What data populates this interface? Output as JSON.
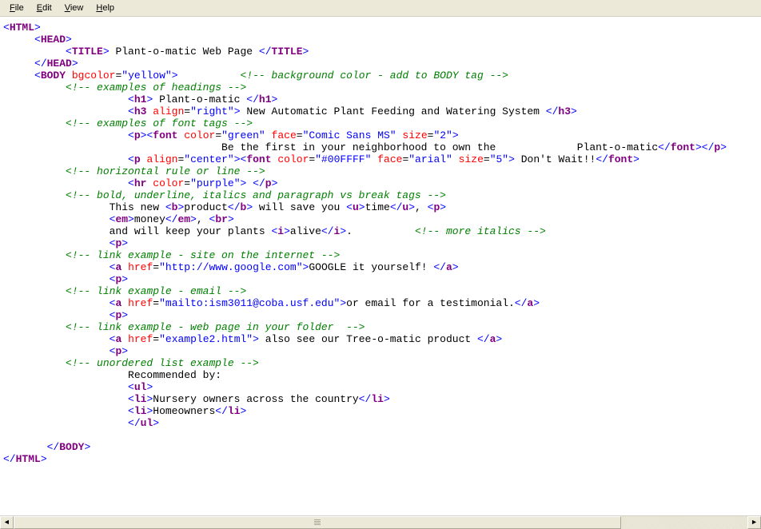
{
  "menubar": {
    "items": [
      {
        "hot": "F",
        "rest": "ile"
      },
      {
        "hot": "E",
        "rest": "dit"
      },
      {
        "hot": "V",
        "rest": "iew"
      },
      {
        "hot": "H",
        "rest": "elp"
      }
    ]
  },
  "code": {
    "lines": [
      [
        [
          "punct",
          "<"
        ],
        [
          "tag",
          "HTML"
        ],
        [
          "punct",
          ">"
        ]
      ],
      [
        [
          "plain",
          "     "
        ],
        [
          "punct",
          "<"
        ],
        [
          "tag",
          "HEAD"
        ],
        [
          "punct",
          ">"
        ]
      ],
      [
        [
          "plain",
          "          "
        ],
        [
          "punct",
          "<"
        ],
        [
          "tag",
          "TITLE"
        ],
        [
          "punct",
          ">"
        ],
        [
          "plain",
          " Plant-o-matic Web Page "
        ],
        [
          "punct",
          "</"
        ],
        [
          "tag",
          "TITLE"
        ],
        [
          "punct",
          ">"
        ]
      ],
      [
        [
          "plain",
          "     "
        ],
        [
          "punct",
          "</"
        ],
        [
          "tag",
          "HEAD"
        ],
        [
          "punct",
          ">"
        ]
      ],
      [
        [
          "plain",
          "     "
        ],
        [
          "punct",
          "<"
        ],
        [
          "tag",
          "BODY"
        ],
        [
          "plain",
          " "
        ],
        [
          "attr",
          "bgcolor"
        ],
        [
          "plain",
          "="
        ],
        [
          "val",
          "\"yellow\""
        ],
        [
          "punct",
          ">"
        ],
        [
          "plain",
          "          "
        ],
        [
          "cmt",
          "<!-- background color - add to BODY tag -->"
        ]
      ],
      [
        [
          "plain",
          "          "
        ],
        [
          "cmt",
          "<!-- examples of headings -->"
        ]
      ],
      [
        [
          "plain",
          "                    "
        ],
        [
          "punct",
          "<"
        ],
        [
          "tag",
          "h1"
        ],
        [
          "punct",
          ">"
        ],
        [
          "plain",
          " Plant-o-matic "
        ],
        [
          "punct",
          "</"
        ],
        [
          "tag",
          "h1"
        ],
        [
          "punct",
          ">"
        ]
      ],
      [
        [
          "plain",
          "                    "
        ],
        [
          "punct",
          "<"
        ],
        [
          "tag",
          "h3"
        ],
        [
          "plain",
          " "
        ],
        [
          "attr",
          "align"
        ],
        [
          "plain",
          "="
        ],
        [
          "val",
          "\"right\""
        ],
        [
          "punct",
          ">"
        ],
        [
          "plain",
          " New Automatic Plant Feeding and Watering System "
        ],
        [
          "punct",
          "</"
        ],
        [
          "tag",
          "h3"
        ],
        [
          "punct",
          ">"
        ]
      ],
      [
        [
          "plain",
          "          "
        ],
        [
          "cmt",
          "<!-- examples of font tags -->"
        ]
      ],
      [
        [
          "plain",
          "                    "
        ],
        [
          "punct",
          "<"
        ],
        [
          "tag",
          "p"
        ],
        [
          "punct",
          "><"
        ],
        [
          "tag",
          "font"
        ],
        [
          "plain",
          " "
        ],
        [
          "attr",
          "color"
        ],
        [
          "plain",
          "="
        ],
        [
          "val",
          "\"green\""
        ],
        [
          "plain",
          " "
        ],
        [
          "attr",
          "face"
        ],
        [
          "plain",
          "="
        ],
        [
          "val",
          "\"Comic Sans MS\""
        ],
        [
          "plain",
          " "
        ],
        [
          "attr",
          "size"
        ],
        [
          "plain",
          "="
        ],
        [
          "val",
          "\"2\""
        ],
        [
          "punct",
          ">"
        ]
      ],
      [
        [
          "plain",
          "                                   Be the first in your neighborhood to own the             Plant-o-matic"
        ],
        [
          "punct",
          "</"
        ],
        [
          "tag",
          "font"
        ],
        [
          "punct",
          "></"
        ],
        [
          "tag",
          "p"
        ],
        [
          "punct",
          ">"
        ]
      ],
      [
        [
          "plain",
          "                    "
        ],
        [
          "punct",
          "<"
        ],
        [
          "tag",
          "p"
        ],
        [
          "plain",
          " "
        ],
        [
          "attr",
          "align"
        ],
        [
          "plain",
          "="
        ],
        [
          "val",
          "\"center\""
        ],
        [
          "punct",
          "><"
        ],
        [
          "tag",
          "font"
        ],
        [
          "plain",
          " "
        ],
        [
          "attr",
          "color"
        ],
        [
          "plain",
          "="
        ],
        [
          "val",
          "\"#00FFFF\""
        ],
        [
          "plain",
          " "
        ],
        [
          "attr",
          "face"
        ],
        [
          "plain",
          "="
        ],
        [
          "val",
          "\"arial\""
        ],
        [
          "plain",
          " "
        ],
        [
          "attr",
          "size"
        ],
        [
          "plain",
          "="
        ],
        [
          "val",
          "\"5\""
        ],
        [
          "punct",
          ">"
        ],
        [
          "plain",
          " Don't Wait!!"
        ],
        [
          "punct",
          "</"
        ],
        [
          "tag",
          "font"
        ],
        [
          "punct",
          ">"
        ]
      ],
      [
        [
          "plain",
          "          "
        ],
        [
          "cmt",
          "<!-- horizontal rule or line -->"
        ]
      ],
      [
        [
          "plain",
          "                    "
        ],
        [
          "punct",
          "<"
        ],
        [
          "tag",
          "hr"
        ],
        [
          "plain",
          " "
        ],
        [
          "attr",
          "color"
        ],
        [
          "plain",
          "="
        ],
        [
          "val",
          "\"purple\""
        ],
        [
          "punct",
          ">"
        ],
        [
          "plain",
          " "
        ],
        [
          "punct",
          "</"
        ],
        [
          "tag",
          "p"
        ],
        [
          "punct",
          ">"
        ]
      ],
      [
        [
          "plain",
          "          "
        ],
        [
          "cmt",
          "<!-- bold, underline, italics and paragraph vs break tags -->"
        ]
      ],
      [
        [
          "plain",
          "                 This new "
        ],
        [
          "punct",
          "<"
        ],
        [
          "tag",
          "b"
        ],
        [
          "punct",
          ">"
        ],
        [
          "plain",
          "product"
        ],
        [
          "punct",
          "</"
        ],
        [
          "tag",
          "b"
        ],
        [
          "punct",
          ">"
        ],
        [
          "plain",
          " will save you "
        ],
        [
          "punct",
          "<"
        ],
        [
          "tag",
          "u"
        ],
        [
          "punct",
          ">"
        ],
        [
          "plain",
          "time"
        ],
        [
          "punct",
          "</"
        ],
        [
          "tag",
          "u"
        ],
        [
          "punct",
          ">"
        ],
        [
          "plain",
          ", "
        ],
        [
          "punct",
          "<"
        ],
        [
          "tag",
          "p"
        ],
        [
          "punct",
          ">"
        ]
      ],
      [
        [
          "plain",
          "                 "
        ],
        [
          "punct",
          "<"
        ],
        [
          "tag",
          "em"
        ],
        [
          "punct",
          ">"
        ],
        [
          "plain",
          "money"
        ],
        [
          "punct",
          "</"
        ],
        [
          "tag",
          "em"
        ],
        [
          "punct",
          ">"
        ],
        [
          "plain",
          ", "
        ],
        [
          "punct",
          "<"
        ],
        [
          "tag",
          "br"
        ],
        [
          "punct",
          ">"
        ]
      ],
      [
        [
          "plain",
          "                 and will keep your plants "
        ],
        [
          "punct",
          "<"
        ],
        [
          "tag",
          "i"
        ],
        [
          "punct",
          ">"
        ],
        [
          "plain",
          "alive"
        ],
        [
          "punct",
          "</"
        ],
        [
          "tag",
          "i"
        ],
        [
          "punct",
          ">"
        ],
        [
          "plain",
          ".          "
        ],
        [
          "cmt",
          "<!-- more italics -->"
        ]
      ],
      [
        [
          "plain",
          "                 "
        ],
        [
          "punct",
          "<"
        ],
        [
          "tag",
          "p"
        ],
        [
          "punct",
          ">"
        ]
      ],
      [
        [
          "plain",
          "          "
        ],
        [
          "cmt",
          "<!-- link example - site on the internet -->"
        ]
      ],
      [
        [
          "plain",
          "                 "
        ],
        [
          "punct",
          "<"
        ],
        [
          "tag",
          "a"
        ],
        [
          "plain",
          " "
        ],
        [
          "attr",
          "href"
        ],
        [
          "plain",
          "="
        ],
        [
          "val",
          "\"http://www.google.com\""
        ],
        [
          "punct",
          ">"
        ],
        [
          "plain",
          "GOOGLE it yourself! "
        ],
        [
          "punct",
          "</"
        ],
        [
          "tag",
          "a"
        ],
        [
          "punct",
          ">"
        ]
      ],
      [
        [
          "plain",
          "                 "
        ],
        [
          "punct",
          "<"
        ],
        [
          "tag",
          "p"
        ],
        [
          "punct",
          ">"
        ]
      ],
      [
        [
          "plain",
          "          "
        ],
        [
          "cmt",
          "<!-- link example - email -->"
        ]
      ],
      [
        [
          "plain",
          "                 "
        ],
        [
          "punct",
          "<"
        ],
        [
          "tag",
          "a"
        ],
        [
          "plain",
          " "
        ],
        [
          "attr",
          "href"
        ],
        [
          "plain",
          "="
        ],
        [
          "val",
          "\"mailto:ism3011@coba.usf.edu\""
        ],
        [
          "punct",
          ">"
        ],
        [
          "plain",
          "or email for a testimonial."
        ],
        [
          "punct",
          "</"
        ],
        [
          "tag",
          "a"
        ],
        [
          "punct",
          ">"
        ]
      ],
      [
        [
          "plain",
          "                 "
        ],
        [
          "punct",
          "<"
        ],
        [
          "tag",
          "p"
        ],
        [
          "punct",
          ">"
        ]
      ],
      [
        [
          "plain",
          "          "
        ],
        [
          "cmt",
          "<!-- link example - web page in your folder  -->"
        ]
      ],
      [
        [
          "plain",
          "                 "
        ],
        [
          "punct",
          "<"
        ],
        [
          "tag",
          "a"
        ],
        [
          "plain",
          " "
        ],
        [
          "attr",
          "href"
        ],
        [
          "plain",
          "="
        ],
        [
          "val",
          "\"example2.html\""
        ],
        [
          "punct",
          ">"
        ],
        [
          "plain",
          " also see our Tree-o-matic product "
        ],
        [
          "punct",
          "</"
        ],
        [
          "tag",
          "a"
        ],
        [
          "punct",
          ">"
        ]
      ],
      [
        [
          "plain",
          "                 "
        ],
        [
          "punct",
          "<"
        ],
        [
          "tag",
          "p"
        ],
        [
          "punct",
          ">"
        ]
      ],
      [
        [
          "plain",
          "          "
        ],
        [
          "cmt",
          "<!-- unordered list example -->"
        ]
      ],
      [
        [
          "plain",
          "                    Recommended by:"
        ]
      ],
      [
        [
          "plain",
          "                    "
        ],
        [
          "punct",
          "<"
        ],
        [
          "tag",
          "ul"
        ],
        [
          "punct",
          ">"
        ]
      ],
      [
        [
          "plain",
          "                    "
        ],
        [
          "punct",
          "<"
        ],
        [
          "tag",
          "li"
        ],
        [
          "punct",
          ">"
        ],
        [
          "plain",
          "Nursery owners across the country"
        ],
        [
          "punct",
          "</"
        ],
        [
          "tag",
          "li"
        ],
        [
          "punct",
          ">"
        ]
      ],
      [
        [
          "plain",
          "                    "
        ],
        [
          "punct",
          "<"
        ],
        [
          "tag",
          "li"
        ],
        [
          "punct",
          ">"
        ],
        [
          "plain",
          "Homeowners"
        ],
        [
          "punct",
          "</"
        ],
        [
          "tag",
          "li"
        ],
        [
          "punct",
          ">"
        ]
      ],
      [
        [
          "plain",
          "                    "
        ],
        [
          "punct",
          "</"
        ],
        [
          "tag",
          "ul"
        ],
        [
          "punct",
          ">"
        ]
      ],
      [
        [
          "plain",
          " "
        ]
      ],
      [
        [
          "plain",
          "       "
        ],
        [
          "punct",
          "</"
        ],
        [
          "tag",
          "BODY"
        ],
        [
          "punct",
          ">"
        ]
      ],
      [
        [
          "punct",
          "</"
        ],
        [
          "tag",
          "HTML"
        ],
        [
          "punct",
          ">"
        ]
      ]
    ]
  },
  "scrollbar": {
    "left_arrow": "◄",
    "right_arrow": "►"
  }
}
